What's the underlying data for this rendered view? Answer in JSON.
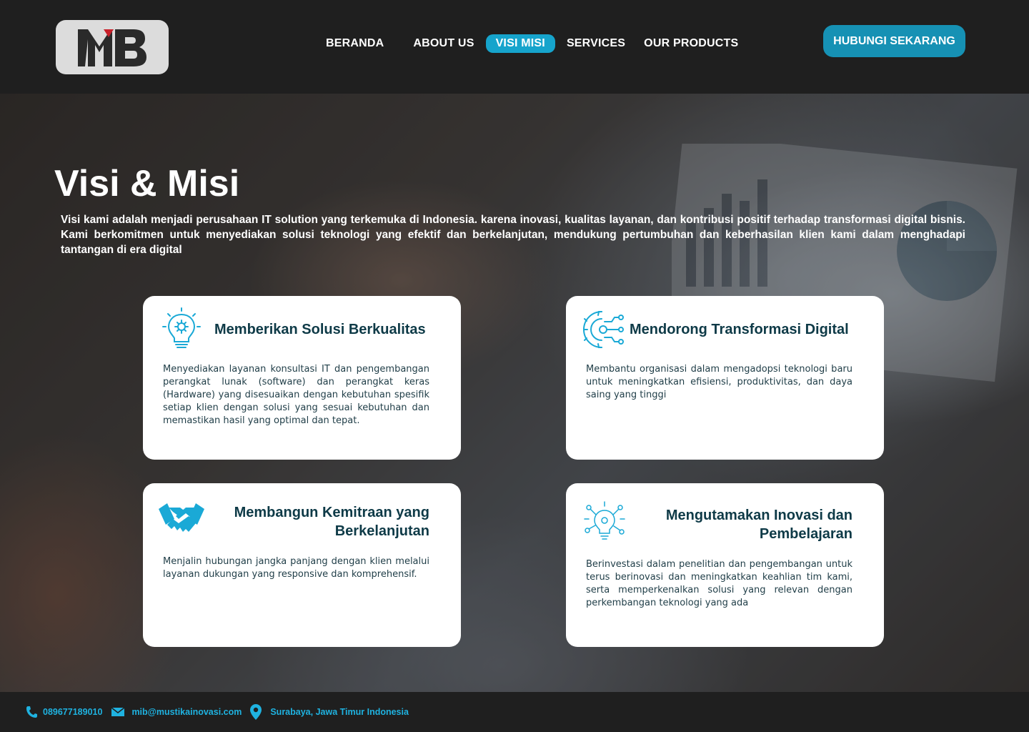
{
  "brand": {
    "logo_text": "MB",
    "accent": "#16a4cc",
    "logo_red": "#c8202a"
  },
  "nav": {
    "items": [
      {
        "label": "BERANDA"
      },
      {
        "label": "ABOUT US"
      },
      {
        "label": "VISI MISI",
        "active": true
      },
      {
        "label": "SERVICES"
      },
      {
        "label": "OUR PRODUCTS"
      }
    ],
    "cta_label": "HUBUNGI SEKARANG"
  },
  "hero": {
    "title": "Visi & Misi",
    "description": "Visi kami adalah menjadi perusahaan IT solution yang terkemuka di Indonesia. karena inovasi, kualitas layanan, dan kontribusi positif terhadap transformasi digital bisnis. Kami berkomitmen untuk menyediakan solusi teknologi yang efektif dan berkelanjutan, mendukung pertumbuhan dan keberhasilan klien kami dalam menghadapi tantangan di era digital"
  },
  "cards": [
    {
      "icon": "lightbulb-gear-icon",
      "title": "Memberikan Solusi Berkualitas",
      "text": "Menyediakan layanan konsultasi IT dan pengembangan perangkat lunak (software) dan perangkat keras (Hardware) yang disesuaikan dengan kebutuhan spesifik setiap klien dengan solusi yang sesuai kebutuhan dan memastikan hasil yang optimal dan tepat."
    },
    {
      "icon": "digital-gear-icon",
      "title": "Mendorong Transformasi Digital",
      "text": "Membantu organisasi dalam mengadopsi teknologi baru untuk meningkatkan efisiensi, produktivitas, dan daya saing yang tinggi"
    },
    {
      "icon": "handshake-icon",
      "title": "Membangun Kemitraan yang Berkelanjutan",
      "text": "Menjalin hubungan jangka panjang dengan klien melalui layanan dukungan yang responsive dan komprehensif."
    },
    {
      "icon": "innovation-icon",
      "title": "Mengutamakan Inovasi dan Pembelajaran",
      "text": "Berinvestasi dalam penelitian dan pengembangan untuk terus berinovasi dan meningkatkan keahlian tim kami, serta memperkenalkan solusi yang relevan dengan perkembangan teknologi yang ada"
    }
  ],
  "footer": {
    "phone": "089677189010",
    "email": "mib@mustikainovasi.com",
    "address": "Surabaya, Jawa Timur Indonesia"
  }
}
